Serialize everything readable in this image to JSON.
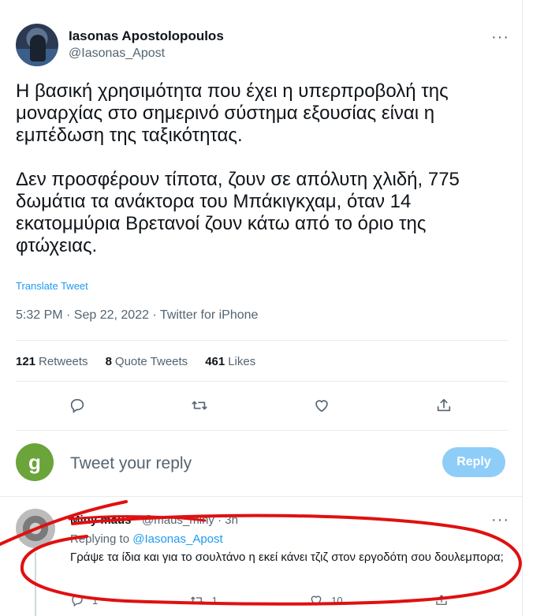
{
  "tweet": {
    "author_name": "Iasonas Apostolopoulos",
    "author_handle": "@Iasonas_Apost",
    "more_label": "···",
    "text": "Η βασική χρησιμότητα που έχει η υπερπροβολή της μοναρχίας στο σημερινό σύστημα εξουσίας είναι η εμπέδωση της ταξικότητας.\n\nΔεν προσφέρουν τίποτα, ζουν σε απόλυτη χλιδή, 775 δωμάτια τα ανάκτορα του Μπάκιγκχαμ, όταν 14 εκατομμύρια Βρετανοί ζουν κάτω από το όριο της φτώχειας.",
    "translate_label": "Translate Tweet",
    "meta": "5:32 PM · Sep 22, 2022 · Twitter for iPhone",
    "stats": {
      "retweets_count": "121",
      "retweets_label": "Retweets",
      "quotes_count": "8",
      "quotes_label": "Quote Tweets",
      "likes_count": "461",
      "likes_label": "Likes"
    },
    "actions": [
      "reply-icon",
      "retweet-icon",
      "like-icon",
      "share-icon"
    ]
  },
  "reply_box": {
    "avatar_letter": "g",
    "avatar_color": "#6ba43a",
    "placeholder": "Tweet your reply",
    "button_label": "Reply",
    "button_color": "#8ecdf8"
  },
  "reply": {
    "name": "Miny maus",
    "handle_time": "@maus_miny · 3h",
    "more_label": "···",
    "replying_to_prefix": "Replying to",
    "replying_to_handle": "@Iasonas_Apost",
    "text": "Γράψε τα ίδια και για το σουλτάνο η εκεί κάνει τζιζ στον εργοδότη σου δουλεμπορα;",
    "reply_count": "1",
    "retweet_count": "1",
    "like_count": "10"
  },
  "colors": {
    "accent": "#1d9bf0",
    "annotation": "#e01010",
    "secondary_text": "#536471"
  }
}
